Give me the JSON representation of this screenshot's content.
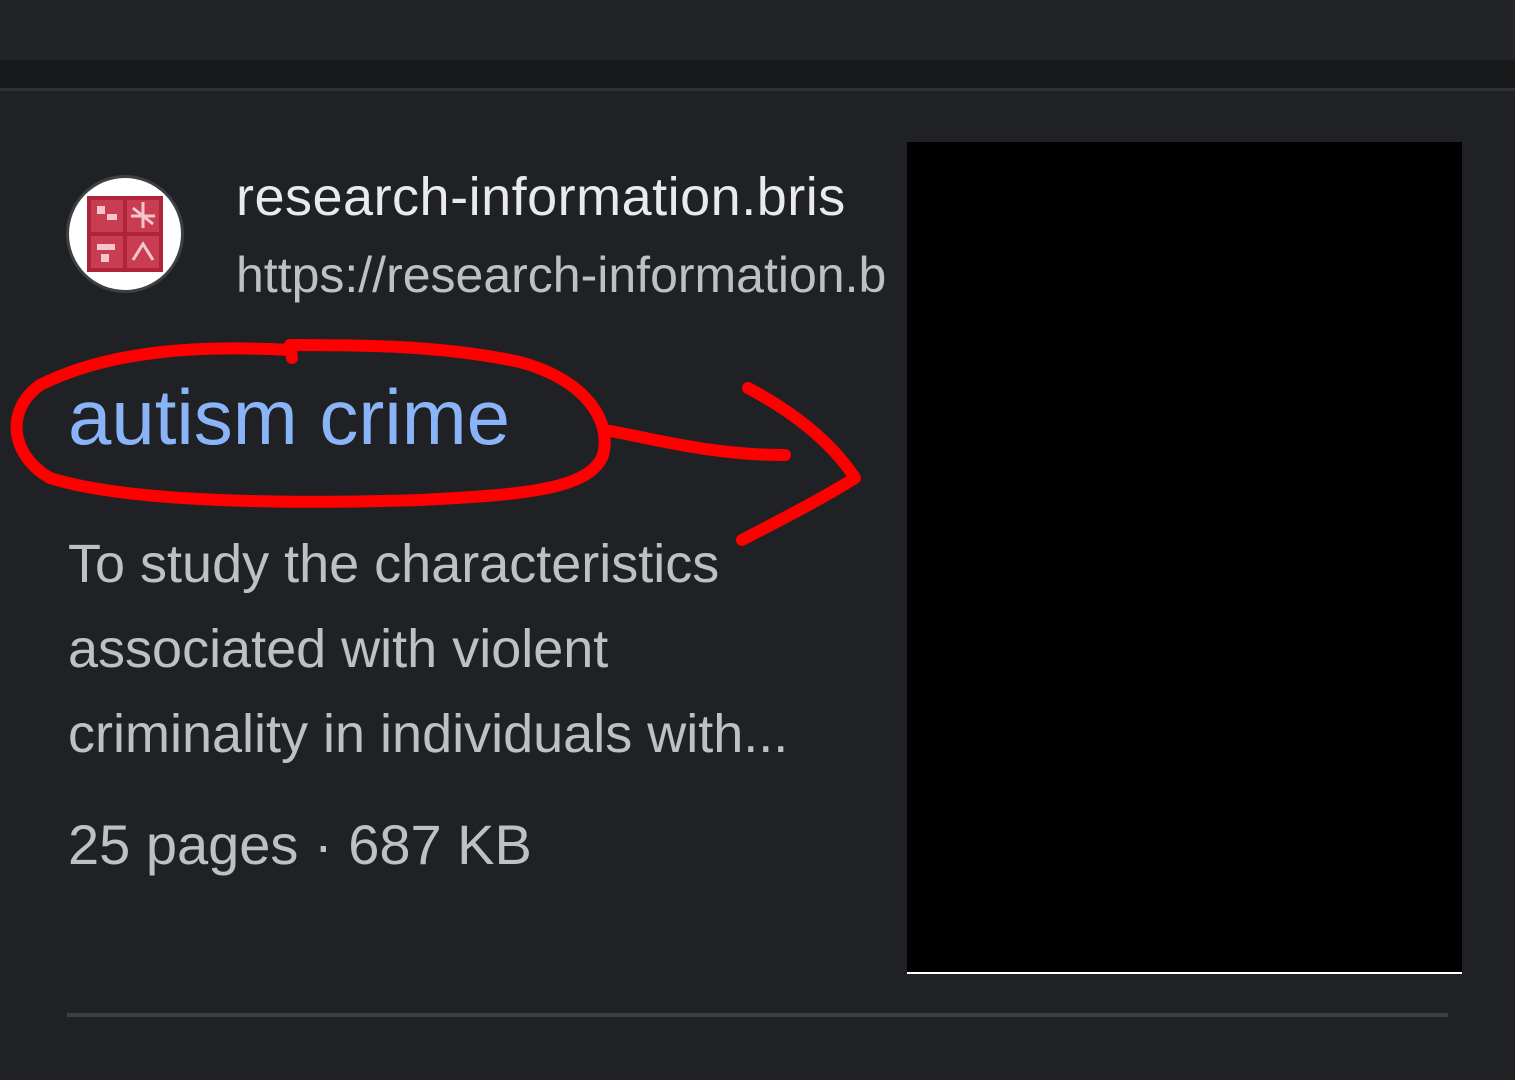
{
  "result": {
    "site_name": "research-information.bris",
    "site_url": "https://research-information.b",
    "title": "autism crime",
    "snippet_lines": [
      "To study the characteristics",
      "associated with violent",
      "criminality in individuals with..."
    ],
    "meta": "25 pages · 687 KB",
    "favicon_icon": "university-crest-icon"
  },
  "colors": {
    "background": "#202124",
    "link": "#8ab4f8",
    "primary_text": "#e8eaed",
    "secondary_text": "#bdc1c6",
    "annotation": "#ff0000",
    "redaction": "#000000"
  }
}
